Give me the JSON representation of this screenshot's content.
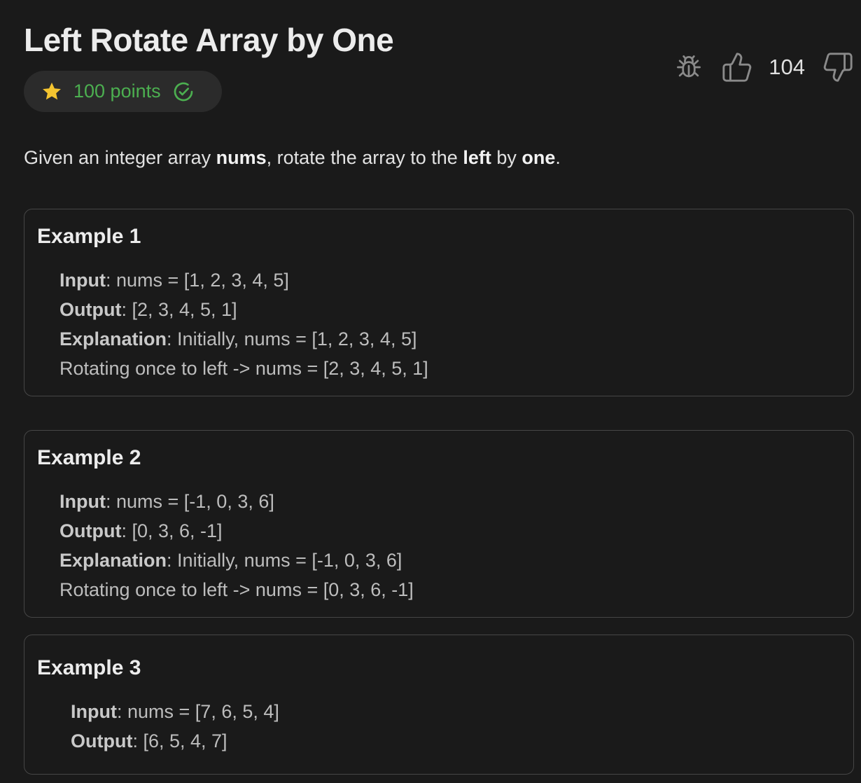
{
  "problem": {
    "title": "Left Rotate Array by One",
    "points_label": "100 points",
    "like_count": "104",
    "description": {
      "prefix": "Given an integer array ",
      "term1": "nums",
      "middle1": ", rotate the array to the ",
      "term2": "left",
      "middle2": " by ",
      "term3": "one",
      "suffix": "."
    }
  },
  "icons": {
    "star": "star-icon",
    "check": "check-circle-icon",
    "bug": "bug-icon",
    "like": "thumbs-up-icon",
    "dislike": "thumbs-down-icon"
  },
  "colors": {
    "background": "#1a1a1a",
    "points_green": "#4caf50",
    "star_yellow": "#f4c430",
    "border": "#464646"
  },
  "examples": [
    {
      "title": "Example 1",
      "input_label": "Input",
      "input_value": " nums = [1, 2, 3, 4, 5]",
      "output_label": "Output",
      "output_value": " [2, 3, 4, 5, 1]",
      "explanation_label": "Explanation",
      "explanation_value": " Initially, nums = [1, 2, 3, 4, 5]",
      "explanation_line2": "Rotating once to left -> nums = [2, 3, 4, 5, 1]"
    },
    {
      "title": "Example 2",
      "input_label": "Input",
      "input_value": " nums = [-1, 0, 3, 6]",
      "output_label": "Output",
      "output_value": " [0, 3, 6, -1]",
      "explanation_label": "Explanation",
      "explanation_value": " Initially, nums = [-1, 0, 3, 6]",
      "explanation_line2": "Rotating once to left -> nums = [0, 3, 6, -1]"
    },
    {
      "title": "Example 3",
      "input_label": "Input",
      "input_value": " nums = [7, 6, 5, 4]",
      "output_label": "Output",
      "output_value": " [6, 5, 4, 7]"
    }
  ],
  "punct": {
    "colon": ":"
  }
}
